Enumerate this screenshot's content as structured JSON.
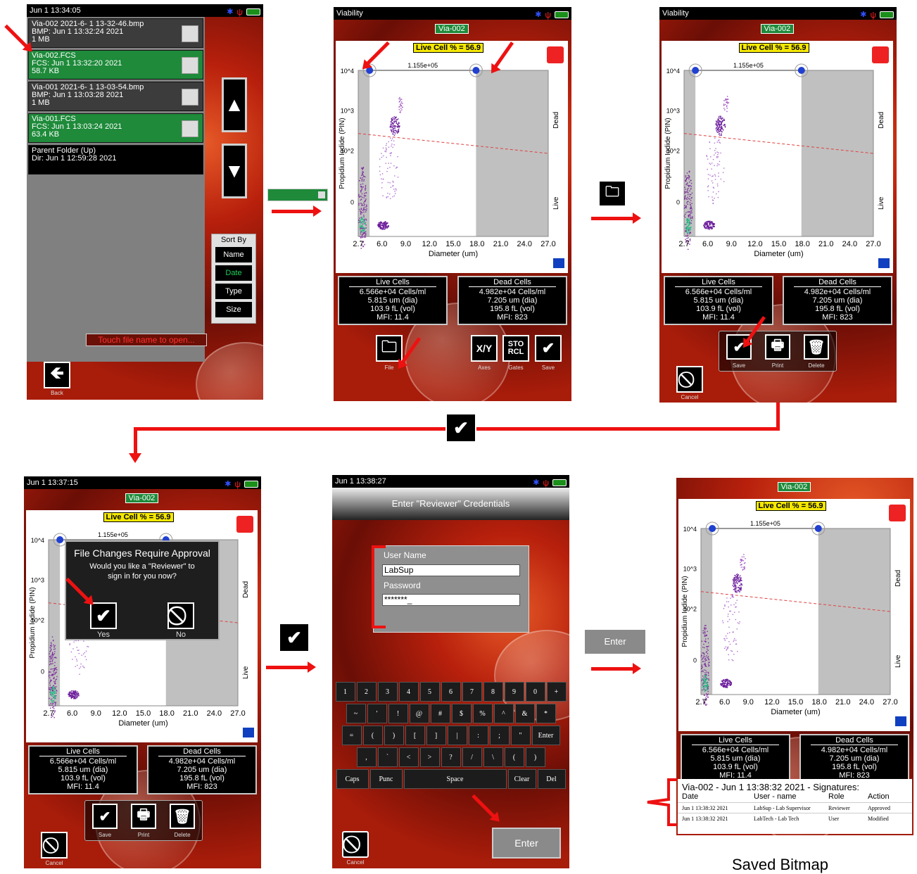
{
  "screen1": {
    "status_time": "Jun  1 13:34:05",
    "files": [
      {
        "name": "Via-002 2021-6- 1 13-32-46.bmp",
        "meta": "BMP: Jun  1 13:32:24 2021",
        "size": "1 MB",
        "type": "bmp"
      },
      {
        "name": "Via-002.FCS",
        "meta": "FCS: Jun  1 13:32:20 2021",
        "size": "58.7 KB",
        "type": "fcs"
      },
      {
        "name": "Via-001 2021-6- 1 13-03-54.bmp",
        "meta": "BMP: Jun  1 13:03:28 2021",
        "size": "1 MB",
        "type": "bmp"
      },
      {
        "name": "Via-001.FCS",
        "meta": "FCS: Jun  1 13:03:24 2021",
        "size": "63.4 KB",
        "type": "fcs"
      },
      {
        "name": "Parent Folder (Up)",
        "meta": "Dir: Jun  1 12:59:28 2021",
        "size": "",
        "type": "up"
      }
    ],
    "sort_by_label": "Sort By",
    "sort_options": [
      "Name",
      "Date",
      "Type",
      "Size"
    ],
    "sort_selected": "Date",
    "touch_msg": "Touch file name to open...",
    "back_label": "Back"
  },
  "plot": {
    "title": "Viability",
    "tag": "Via-002",
    "live_pct": "Live Cell % = 56.9",
    "gate_width": "1.155e+05",
    "ylabel": "Propidium Iodide (PIN)",
    "xlabel": "Diameter (um)",
    "xticks": [
      "2.7",
      "6.0",
      "9.0",
      "12.0",
      "15.0",
      "18.0",
      "21.0",
      "24.0",
      "27.0"
    ],
    "yticks": [
      "10^4",
      "10^3",
      "10^2",
      "0"
    ],
    "dead_label": "Dead",
    "live_label": "Live",
    "live": {
      "title": "Live Cells",
      "conc": "6.566e+04 Cells/ml",
      "dia": "5.815 um (dia)",
      "vol": "103.9 fL (vol)",
      "mfi": "MFI:  11.4"
    },
    "dead": {
      "title": "Dead Cells",
      "conc": "4.982e+04 Cells/ml",
      "dia": "7.205 um (dia)",
      "vol": "195.8 fL (vol)",
      "mfi": "MFI:   823"
    }
  },
  "screen2_buttons": {
    "file": "File",
    "axes": "Axes",
    "gates": "Gates",
    "save": "Save",
    "xy": "X/Y",
    "stor": "STO",
    "rcl": "RCL"
  },
  "tray_labels": {
    "save": "Save",
    "print": "Print",
    "delete": "Delete",
    "cancel": "Cancel"
  },
  "screen4": {
    "time": "Jun  1 13:37:15",
    "dlg_title": "File Changes Require Approval",
    "dlg_line1": "Would you like a \"Reviewer\" to",
    "dlg_line2": "sign in for you now?",
    "yes": "Yes",
    "no": "No"
  },
  "screen5": {
    "time": "Jun  1 13:38:27",
    "header": "Enter \"Reviewer\" Credentials",
    "user_label": "User Name",
    "user_value": "LabSup",
    "pass_label": "Password",
    "pass_value": "*******_",
    "row1": [
      "1",
      "2",
      "3",
      "4",
      "5",
      "6",
      "7",
      "8",
      "9",
      "0",
      "+"
    ],
    "row2": [
      "~",
      "'",
      "!",
      "@",
      "#",
      "$",
      "%",
      "^",
      "&",
      "*"
    ],
    "row3": [
      "=",
      "(",
      ")",
      "[",
      "]",
      "|",
      ":",
      ";",
      "\"",
      "Enter"
    ],
    "row4": [
      ",",
      "`",
      "<",
      ">",
      "?",
      "/",
      "\\",
      "(",
      ")"
    ],
    "row5": [
      "Caps",
      "Punc",
      "Space",
      "Clear",
      "Del"
    ],
    "enter": "Enter",
    "cancel": "Cancel"
  },
  "mid_enter_label": "Enter",
  "signatures": {
    "title": "Via-002 - Jun  1 13:38:32 2021 - Signatures:",
    "headers": [
      "Date",
      "User - name",
      "Role",
      "Action"
    ],
    "rows": [
      [
        "Jun  1 13:38:32 2021",
        "LabSup - Lab Supervisor",
        "Reviewer",
        "Approved"
      ],
      [
        "Jun  1 13:38:32 2021",
        "LabTech - Lab Tech",
        "User",
        "Modified"
      ]
    ]
  },
  "caption": "Saved Bitmap",
  "colors": {
    "accent_red": "#ee1111",
    "fcs_green": "#1e8a3a",
    "live_pct_yellow": "#f5e800",
    "gate_grey": "#c0c0c0"
  }
}
